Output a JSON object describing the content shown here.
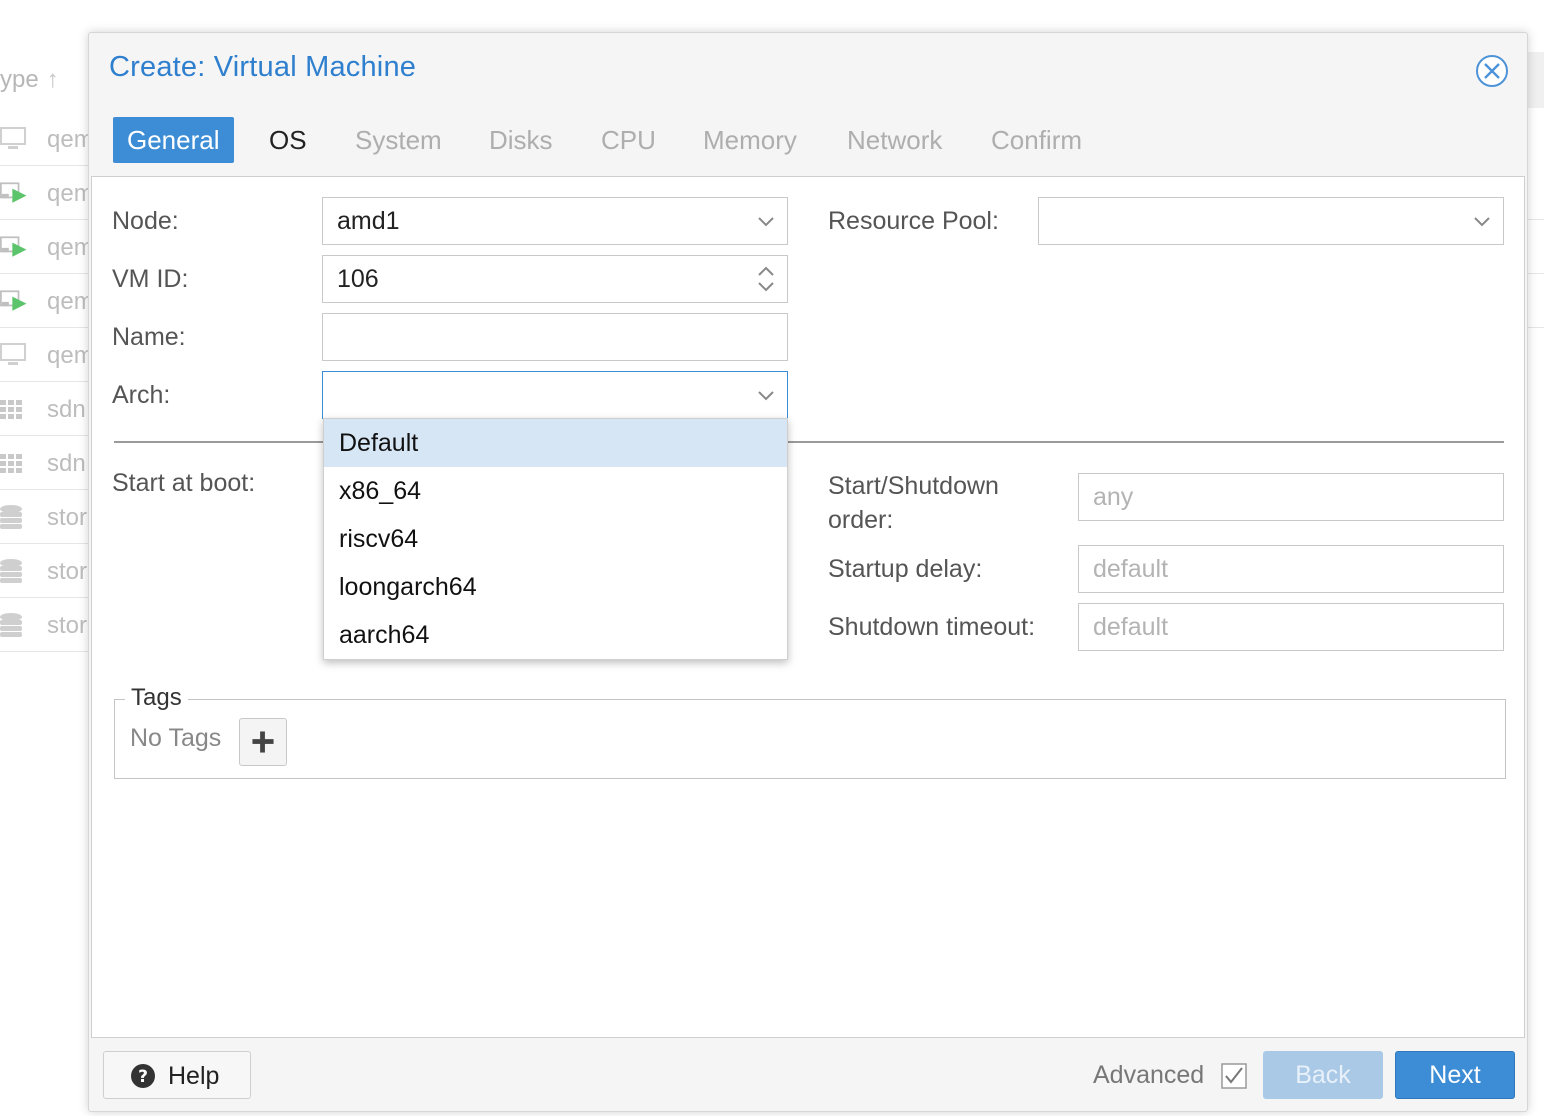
{
  "background": {
    "header_label": "ype",
    "rows": [
      {
        "icon": "vm-stopped-icon",
        "text": "qem"
      },
      {
        "icon": "vm-running-icon",
        "text": "qem"
      },
      {
        "icon": "vm-running-icon",
        "text": "qem"
      },
      {
        "icon": "vm-running-icon",
        "text": "qem"
      },
      {
        "icon": "vm-stopped-icon",
        "text": "qem"
      },
      {
        "icon": "sdn-icon",
        "text": "sdn"
      },
      {
        "icon": "sdn-icon",
        "text": "sdn"
      },
      {
        "icon": "storage-icon",
        "text": "stor"
      },
      {
        "icon": "storage-icon",
        "text": "stor"
      },
      {
        "icon": "storage-icon",
        "text": "stor"
      }
    ]
  },
  "dialog": {
    "title": "Create: Virtual Machine",
    "tabs": [
      {
        "label": "General",
        "state": "active"
      },
      {
        "label": "OS",
        "state": "enabled"
      },
      {
        "label": "System",
        "state": "disabled"
      },
      {
        "label": "Disks",
        "state": "disabled"
      },
      {
        "label": "CPU",
        "state": "disabled"
      },
      {
        "label": "Memory",
        "state": "disabled"
      },
      {
        "label": "Network",
        "state": "disabled"
      },
      {
        "label": "Confirm",
        "state": "disabled"
      }
    ],
    "form": {
      "node_label": "Node:",
      "node_value": "amd1",
      "vmid_label": "VM ID:",
      "vmid_value": "106",
      "name_label": "Name:",
      "name_value": "",
      "arch_label": "Arch:",
      "arch_value": "",
      "pool_label": "Resource Pool:",
      "pool_value": "",
      "start_at_boot_label": "Start at boot:",
      "start_order_label": "Start/Shutdown order:",
      "start_order_placeholder": "any",
      "startup_delay_label": "Startup delay:",
      "startup_delay_placeholder": "default",
      "shutdown_timeout_label": "Shutdown timeout:",
      "shutdown_timeout_placeholder": "default"
    },
    "arch_options": [
      "Default",
      "x86_64",
      "riscv64",
      "loongarch64",
      "aarch64"
    ],
    "arch_highlighted": "Default",
    "tags": {
      "legend": "Tags",
      "empty_text": "No Tags"
    },
    "footer": {
      "help_label": "Help",
      "advanced_label": "Advanced",
      "advanced_checked": true,
      "back_label": "Back",
      "next_label": "Next"
    }
  },
  "colors": {
    "accent": "#3c8dd5",
    "title": "#2f7fcf",
    "highlight": "#d7e6f4",
    "running": "#5cc46a"
  }
}
